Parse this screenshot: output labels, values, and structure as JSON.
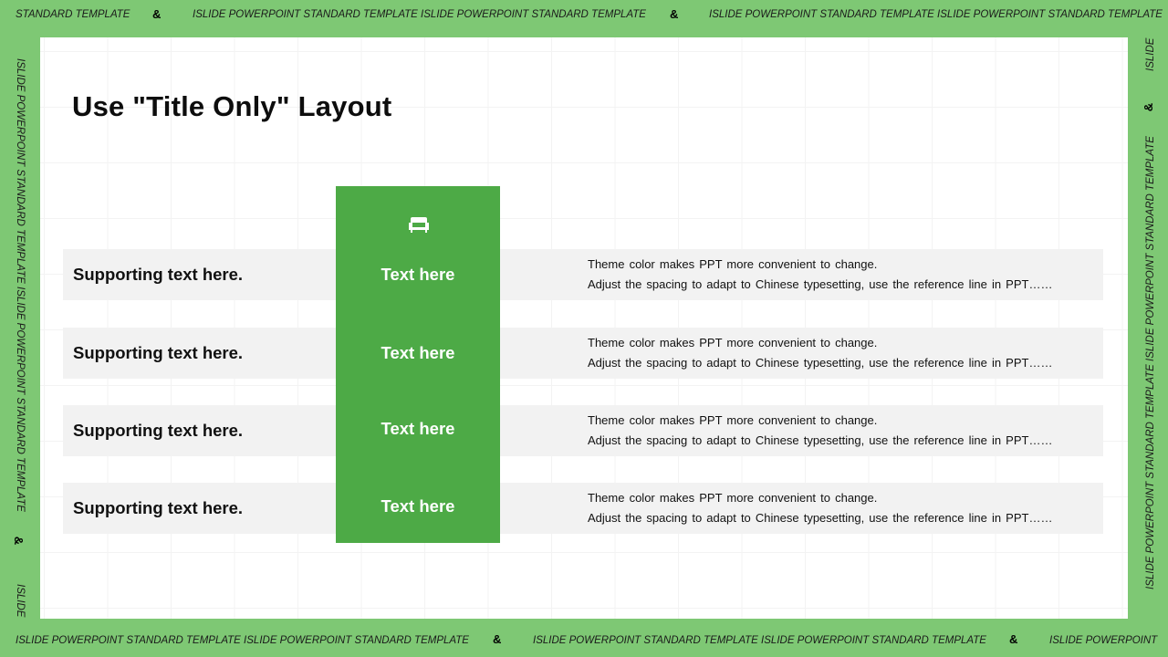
{
  "frame": {
    "top": {
      "segments": [
        "STANDARD TEMPLATE",
        "ISLIDE POWERPOINT STANDARD TEMPLATE ISLIDE POWERPOINT STANDARD TEMPLATE",
        "ISLIDE POWERPOINT STANDARD TEMPLATE ISLIDE POWERPOINT STANDARD TEMPLATE"
      ],
      "separator": "&"
    },
    "bottom": {
      "segments": [
        "ISLIDE POWERPOINT STANDARD TEMPLATE ISLIDE POWERPOINT STANDARD TEMPLATE",
        "ISLIDE POWERPOINT STANDARD TEMPLATE ISLIDE POWERPOINT STANDARD TEMPLATE",
        "ISLIDE POWERPOINT"
      ],
      "separator": "&"
    },
    "left": {
      "segments": [
        "ISLIDE POWERPOINT STANDARD TEMPLATE ISLIDE POWERPOINT STANDARD TEMPLATE",
        "ISLIDE"
      ],
      "separator": "&"
    },
    "right": {
      "segments": [
        "ISLIDE",
        "ISLIDE POWERPOINT STANDARD TEMPLATE ISLIDE POWERPOINT STANDARD TEMPLATE"
      ],
      "separator": "&"
    }
  },
  "slide": {
    "title": "Use \"Title Only\" Layout",
    "icon": "sofa-icon",
    "accent_color": "#4daa46",
    "rows": [
      {
        "label": "Supporting text here.",
        "center": "Text here",
        "desc_line1": "Theme color makes PPT more convenient to change.",
        "desc_line2": "Adjust the spacing to adapt to Chinese typesetting, use the reference line in PPT……"
      },
      {
        "label": "Supporting text here.",
        "center": "Text here",
        "desc_line1": "Theme color makes PPT more convenient to change.",
        "desc_line2": "Adjust the spacing to adapt to Chinese typesetting, use the reference line in PPT……"
      },
      {
        "label": "Supporting text here.",
        "center": "Text here",
        "desc_line1": "Theme color makes PPT more convenient to change.",
        "desc_line2": "Adjust the spacing to adapt to Chinese typesetting, use the reference line in PPT……"
      },
      {
        "label": "Supporting text here.",
        "center": "Text here",
        "desc_line1": "Theme color makes PPT more convenient to change.",
        "desc_line2": "Adjust the spacing to adapt to Chinese typesetting, use the reference line in PPT……"
      }
    ]
  }
}
